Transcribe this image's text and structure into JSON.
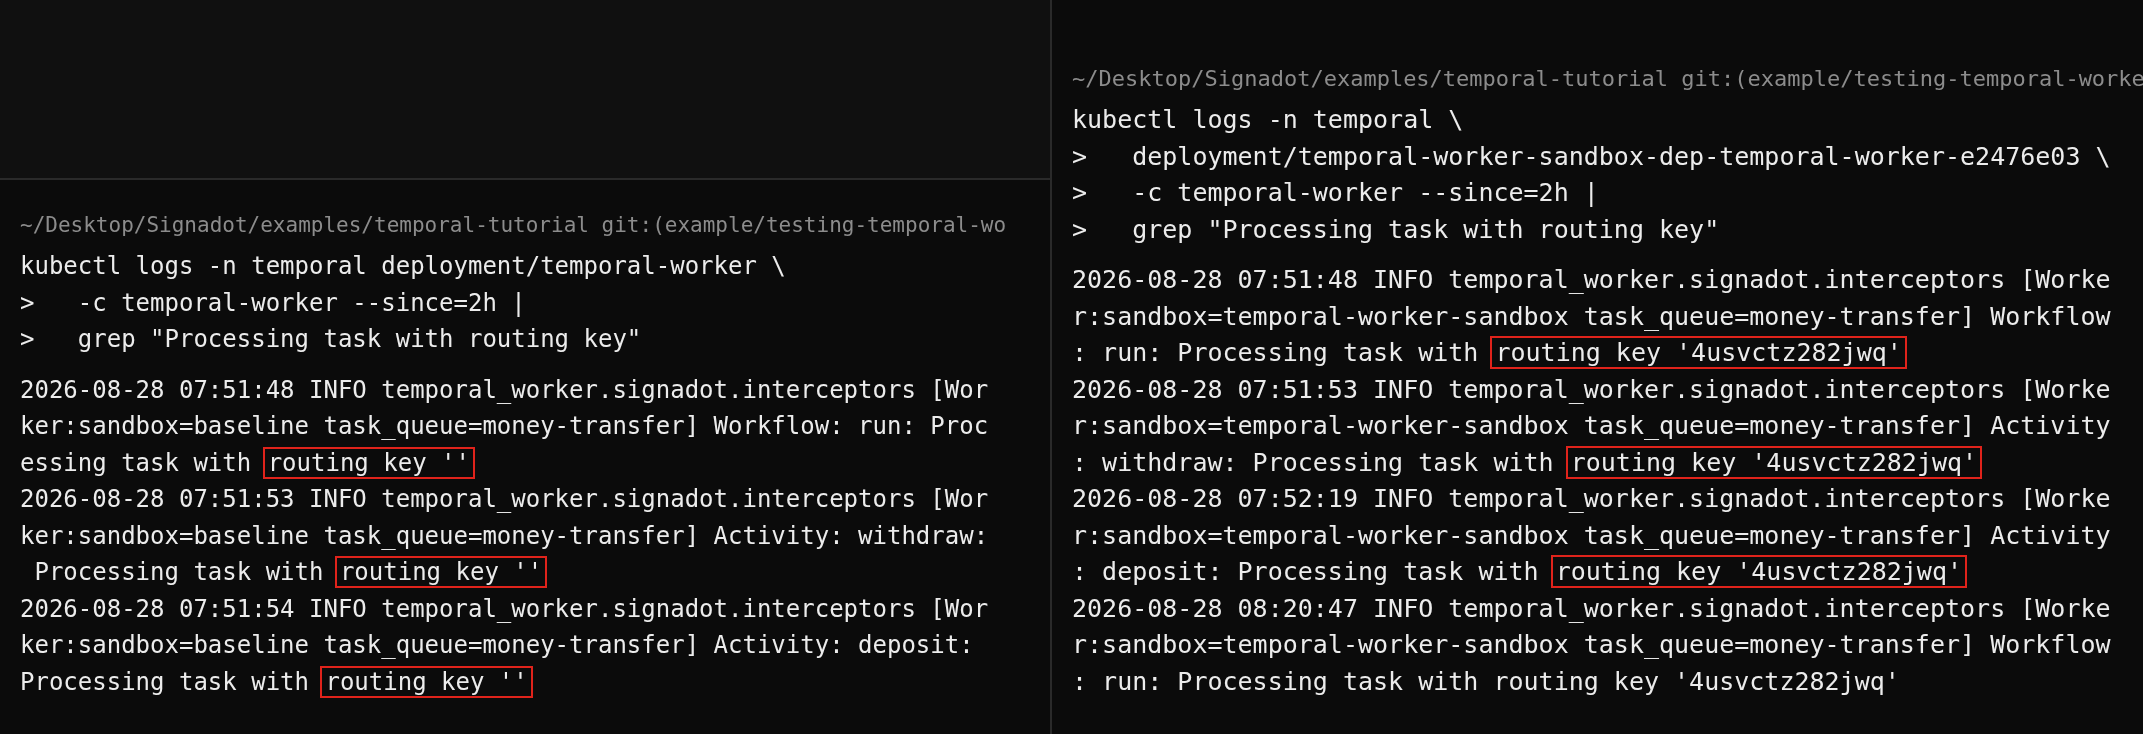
{
  "panels": [
    {
      "prompt": "~/Desktop/Signadot/examples/temporal-tutorial git:(example/testing-temporal-wo",
      "command_lines": [
        "kubectl logs -n temporal deployment/temporal-worker \\",
        ">   -c temporal-worker --since=2h |",
        ">   grep \"Processing task with routing key\""
      ],
      "output_lines": [
        {
          "text": "2026-08-28 07:51:48 INFO temporal_worker.signadot.interceptors [Wor"
        },
        {
          "text": "ker:sandbox=baseline task_queue=money-transfer] Workflow: run: Proc"
        },
        {
          "text": "essing task with ",
          "boxed": "routing key ''"
        },
        {
          "text": "2026-08-28 07:51:53 INFO temporal_worker.signadot.interceptors [Wor"
        },
        {
          "text": "ker:sandbox=baseline task_queue=money-transfer] Activity: withdraw:"
        },
        {
          "text": " Processing task with ",
          "boxed": "routing key ''"
        },
        {
          "text": "2026-08-28 07:51:54 INFO temporal_worker.signadot.interceptors [Wor"
        },
        {
          "text": "ker:sandbox=baseline task_queue=money-transfer] Activity: deposit:"
        },
        {
          "text": "Processing task with ",
          "boxed": "routing key ''"
        }
      ]
    },
    {
      "prompt": "~/Desktop/Signadot/examples/temporal-tutorial git:(example/testing-temporal-worke",
      "command_lines": [
        "kubectl logs -n temporal \\",
        ">   deployment/temporal-worker-sandbox-dep-temporal-worker-e2476e03 \\",
        ">   -c temporal-worker --since=2h |",
        ">   grep \"Processing task with routing key\""
      ],
      "output_lines": [
        {
          "text": "2026-08-28 07:51:48 INFO temporal_worker.signadot.interceptors [Worke"
        },
        {
          "text": "r:sandbox=temporal-worker-sandbox task_queue=money-transfer] Workflow"
        },
        {
          "text": ": run: Processing task with ",
          "boxed": "routing key '4usvctz282jwq'"
        },
        {
          "text": "2026-08-28 07:51:53 INFO temporal_worker.signadot.interceptors [Worke"
        },
        {
          "text": "r:sandbox=temporal-worker-sandbox task_queue=money-transfer] Activity"
        },
        {
          "text": ": withdraw: Processing task with ",
          "boxed": "routing key '4usvctz282jwq'"
        },
        {
          "text": "2026-08-28 07:52:19 INFO temporal_worker.signadot.interceptors [Worke"
        },
        {
          "text": "r:sandbox=temporal-worker-sandbox task_queue=money-transfer] Activity"
        },
        {
          "text": ": deposit: Processing task with ",
          "boxed": "routing key '4usvctz282jwq'"
        },
        {
          "text": "2026-08-28 08:20:47 INFO temporal_worker.signadot.interceptors [Worke"
        },
        {
          "text": "r:sandbox=temporal-worker-sandbox task_queue=money-transfer] Workflow"
        },
        {
          "text": ": run: Processing task with routing key '4usvctz282jwq'"
        }
      ]
    }
  ]
}
